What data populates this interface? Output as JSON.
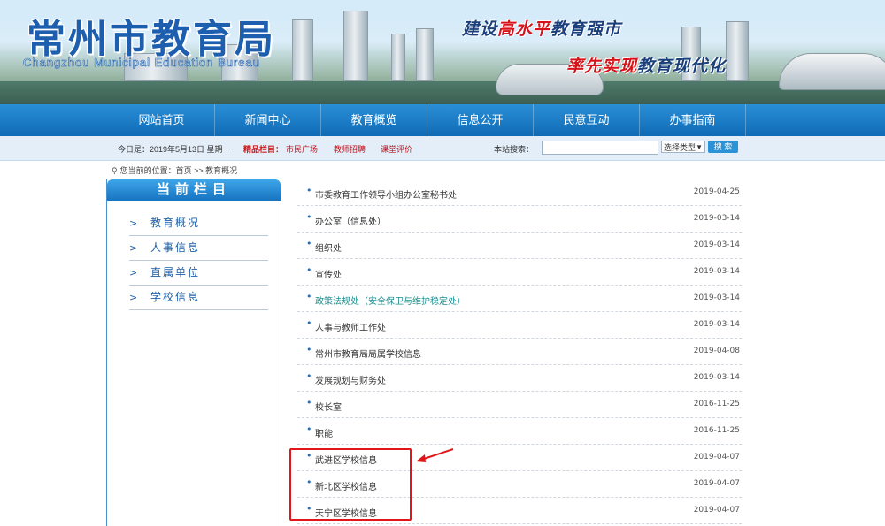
{
  "banner": {
    "title_cn": "常州市教育局",
    "title_en": "Changzhou Municipal Education Bureau",
    "slogan1_a": "建设",
    "slogan1_b": "高水平",
    "slogan1_c": "教育强市",
    "slogan2_a": "率先实现",
    "slogan2_b": "教育现代化",
    "colors": {
      "title": "#1d5fae",
      "slogan_dark": "#1a3f7a",
      "slogan_red": "#d8121a"
    }
  },
  "nav": {
    "items": [
      {
        "label": "网站首页"
      },
      {
        "label": "新闻中心"
      },
      {
        "label": "教育概览"
      },
      {
        "label": "信息公开"
      },
      {
        "label": "民意互动"
      },
      {
        "label": "办事指南"
      }
    ],
    "color": "#1a7cc8"
  },
  "infobar": {
    "date_text": "今日是：2019年5月13日 星期一",
    "featured_label": "精品栏目：",
    "featured_links": [
      "市民广场",
      "教师招聘",
      "课堂评价"
    ],
    "search_label": "本站搜索：",
    "search_placeholder": "",
    "select_value": "选择类型",
    "search_button": "搜 索"
  },
  "breadcrumb": {
    "text": "您当前的位置：首页 >> 教育概况"
  },
  "sidebar": {
    "heading": "当前栏目",
    "items": [
      {
        "label": "教育概况"
      },
      {
        "label": "人事信息"
      },
      {
        "label": "直属单位"
      },
      {
        "label": "学校信息"
      }
    ]
  },
  "list": {
    "rows": [
      {
        "title": "市委教育工作领导小组办公室秘书处",
        "date": "2019-04-25"
      },
      {
        "title": "办公室（信息处）",
        "date": "2019-03-14"
      },
      {
        "title": "组织处",
        "date": "2019-03-14"
      },
      {
        "title": "宣传处",
        "date": "2019-03-14"
      },
      {
        "title": "政策法规处（安全保卫与维护稳定处）",
        "date": "2019-03-14"
      },
      {
        "title": "人事与教师工作处",
        "date": "2019-03-14"
      },
      {
        "title": "常州市教育局局属学校信息",
        "date": "2019-04-08"
      },
      {
        "title": "发展规划与财务处",
        "date": "2019-03-14"
      },
      {
        "title": "校长室",
        "date": "2016-11-25"
      },
      {
        "title": "职能",
        "date": "2016-11-25"
      },
      {
        "title": "武进区学校信息",
        "date": "2019-04-07"
      },
      {
        "title": "新北区学校信息",
        "date": "2019-04-07"
      },
      {
        "title": "天宁区学校信息",
        "date": "2019-04-07"
      }
    ]
  }
}
